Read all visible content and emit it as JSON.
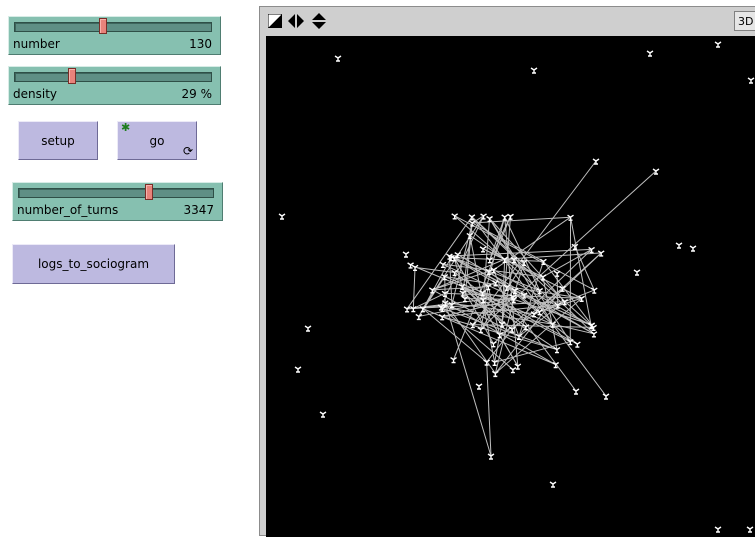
{
  "sliders": [
    {
      "id": "number",
      "label": "number",
      "value": "130",
      "fraction": 0.45
    },
    {
      "id": "density",
      "label": "density",
      "value": "29 %",
      "fraction": 0.29
    },
    {
      "id": "number_of_turns",
      "label": "number_of_turns",
      "value": "3347",
      "fraction": 0.67
    }
  ],
  "buttons": {
    "setup": "setup",
    "go": "go",
    "logs_to_sociogram": "logs_to_sociogram"
  },
  "view": {
    "toggle_3d": "3D",
    "background": "#000000",
    "node_color": "#ffffff",
    "link_color": "#bfbfbf"
  },
  "colors": {
    "slider": "#86c0b0",
    "button": "#bdb9e0",
    "slider_thumb": "#e8837b",
    "forever_star": "#1e7d1e"
  }
}
